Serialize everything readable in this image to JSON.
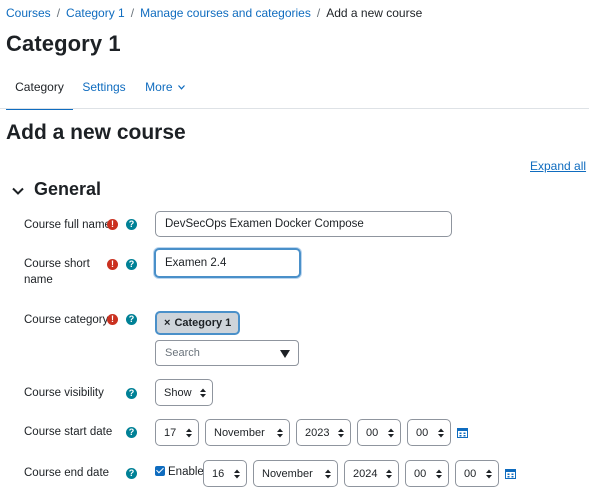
{
  "breadcrumb": {
    "items": [
      "Courses",
      "Category 1",
      "Manage courses and categories"
    ],
    "current": "Add a new course",
    "separator": "/"
  },
  "page_title": "Category 1",
  "tabs": [
    {
      "label": "Category",
      "active": true
    },
    {
      "label": "Settings",
      "active": false
    },
    {
      "label": "More",
      "active": false,
      "icon": "chevron-down-icon"
    }
  ],
  "section_title": "Add a new course",
  "expand_all": "Expand all",
  "general": {
    "title": "General",
    "fields": {
      "full_name": {
        "label": "Course full name",
        "value": "DevSecOps Examen Docker Compose"
      },
      "short_name": {
        "label": "Course short name",
        "value": "Examen 2.4"
      },
      "category": {
        "label": "Course category",
        "selected": "Category 1",
        "remove_glyph": "×",
        "search_placeholder": "Search"
      },
      "visibility": {
        "label": "Course visibility",
        "value": "Show"
      },
      "start_date": {
        "label": "Course start date",
        "day": "17",
        "month": "November",
        "year": "2023",
        "hour": "00",
        "minute": "00"
      },
      "end_date": {
        "label": "Course end date",
        "enable_label": "Enable",
        "enabled": true,
        "day": "16",
        "month": "November",
        "year": "2024",
        "hour": "00",
        "minute": "00"
      }
    }
  },
  "icons": {
    "required": "required-icon",
    "help": "help-icon",
    "calendar": "calendar-icon"
  },
  "colors": {
    "link": "#0f6cbf",
    "required": "#ca3120",
    "help": "#008196",
    "focus": "#4a90c9",
    "chip_bg": "#ced4da"
  }
}
